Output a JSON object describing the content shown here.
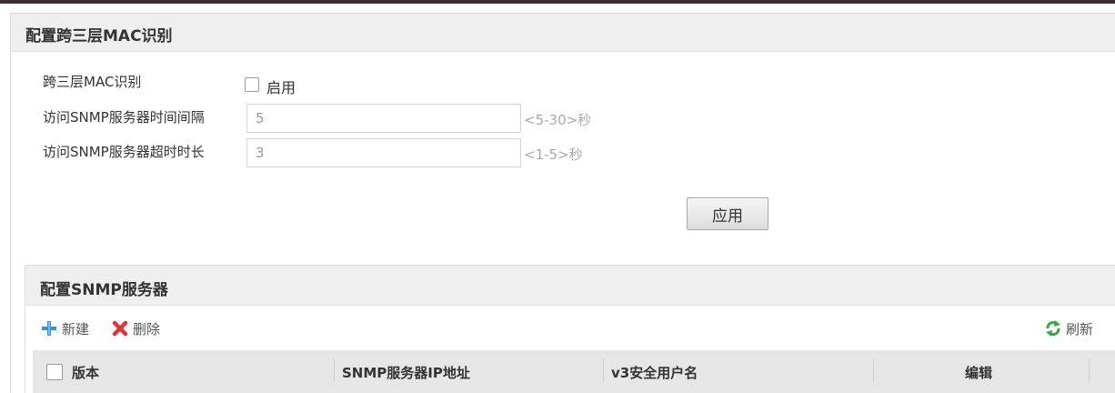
{
  "section1": {
    "title": "配置跨三层MAC识别",
    "cross_mac_label": "跨三层MAC识别",
    "enable_label": "启用",
    "enable_checked": false,
    "interval_label": "访问SNMP服务器时间间隔",
    "interval_value": "5",
    "interval_hint": "<5-30>秒",
    "timeout_label": "访问SNMP服务器超时时长",
    "timeout_value": "3",
    "timeout_hint": "<1-5>秒",
    "apply_label": "应用"
  },
  "section2": {
    "title": "配置SNMP服务器",
    "toolbar": {
      "new_label": "新建",
      "delete_label": "删除",
      "refresh_label": "刷新"
    },
    "table": {
      "columns": [
        "版本",
        "SNMP服务器IP地址",
        "v3安全用户名",
        "编辑"
      ]
    }
  },
  "icons": {
    "new": "plus-icon",
    "delete": "x-delete-icon",
    "refresh": "refresh-icon"
  },
  "colors": {
    "plus": "#3a8fd6",
    "delete": "#d9383a",
    "refresh": "#3aa84a",
    "header_bg": "#efefef",
    "table_header_bg": "#e6e6e6"
  }
}
